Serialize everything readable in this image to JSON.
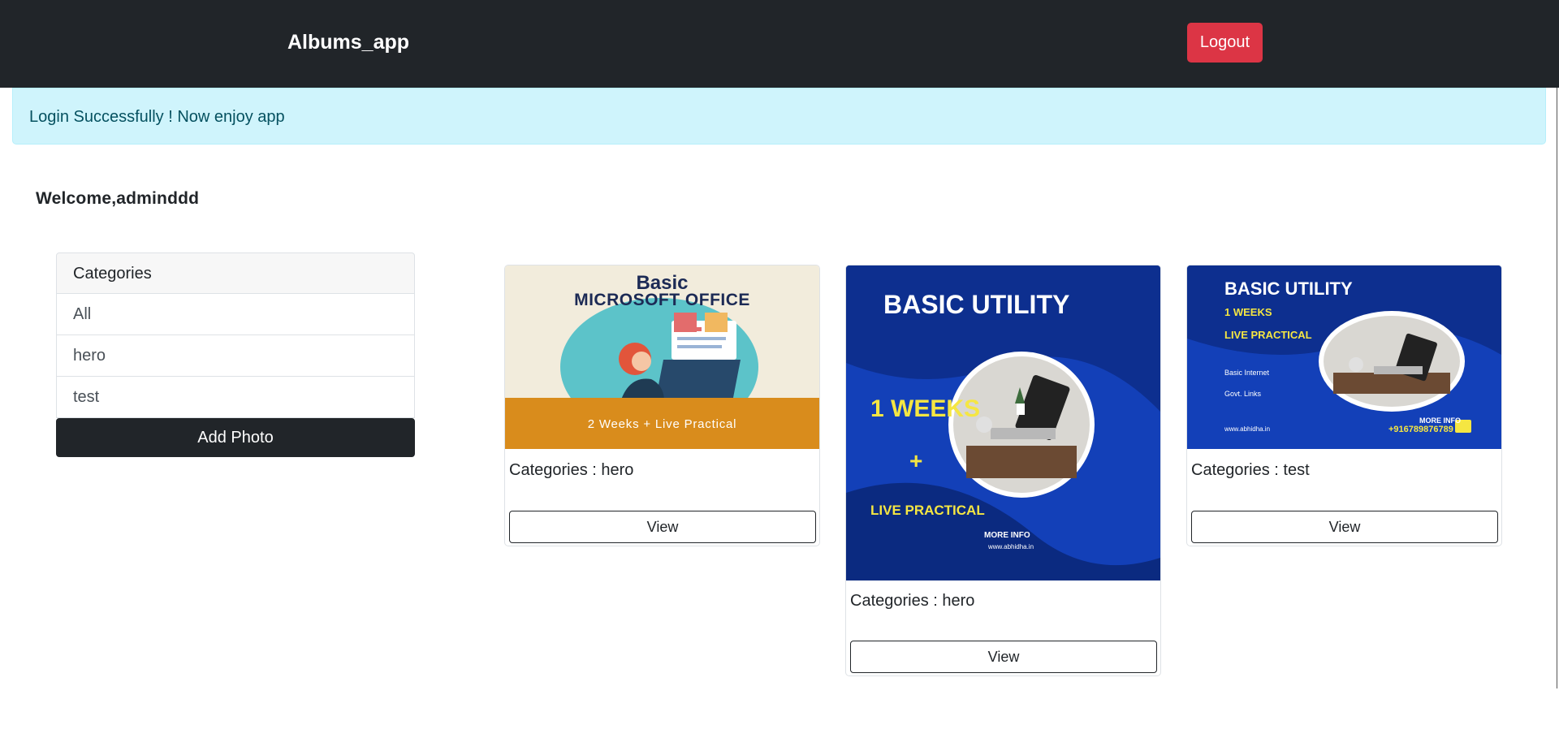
{
  "navbar": {
    "brand": "Albums_app",
    "logout_label": "Logout"
  },
  "alert": {
    "message": "Login Successfully ! Now enjoy app"
  },
  "welcome": "Welcome,adminddd",
  "categories": {
    "header": "Categories",
    "items": [
      "All",
      "hero",
      "test"
    ],
    "add_photo_label": "Add Photo"
  },
  "photos": [
    {
      "category_label": "Categories : hero",
      "view_label": "View",
      "image_text": {
        "line1": "Basic",
        "line2": "MICROSOFT OFFICE",
        "line3": "2 Weeks + Live Practical"
      }
    },
    {
      "category_label": "Categories : hero",
      "view_label": "View",
      "image_text": {
        "line1": "BASIC UTILITY",
        "line2": "1 WEEKS",
        "line3": "+",
        "line4": "LIVE PRACTICAL",
        "line5": "MORE INFO",
        "line6": "www.abhidha.in"
      }
    },
    {
      "category_label": "Categories : test",
      "view_label": "View",
      "image_text": {
        "line1": "BASIC UTILITY",
        "line2": "1 WEEKS",
        "line3": "LIVE PRACTICAL",
        "line4": "Basic Internet",
        "line5": "Govt. Links",
        "line6": "www.abhidha.in",
        "line7": "MORE INFO",
        "line8": "+916789876789"
      }
    }
  ],
  "colors": {
    "navbar_bg": "#212529",
    "logout_bg": "#dc3545",
    "alert_bg": "#cff4fc",
    "alert_text": "#055160",
    "add_photo_bg": "#212529"
  }
}
